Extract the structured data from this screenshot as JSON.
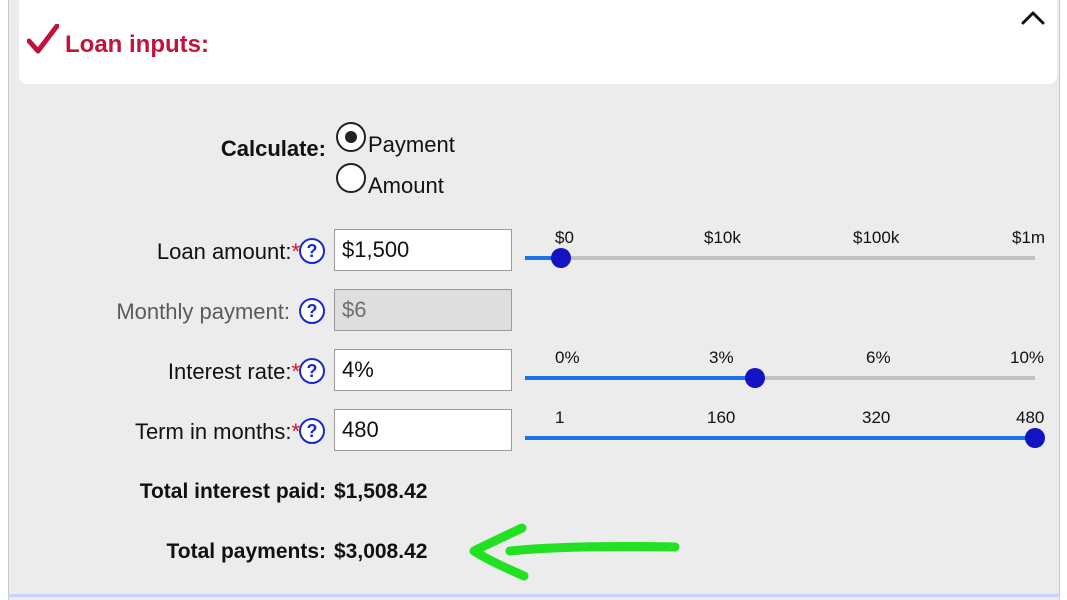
{
  "header": {
    "title": "Loan inputs:"
  },
  "calculate": {
    "label": "Calculate:",
    "options": [
      {
        "label": "Payment",
        "selected": true
      },
      {
        "label": "Amount",
        "selected": false
      }
    ]
  },
  "fields": {
    "loan_amount": {
      "label": "Loan amount:",
      "required_mark": "*",
      "value": "$1,500"
    },
    "monthly_payment": {
      "label": "Monthly payment:",
      "value": "$6"
    },
    "interest_rate": {
      "label": "Interest rate:",
      "required_mark": "*",
      "value": "4%"
    },
    "term": {
      "label": "Term in months:",
      "required_mark": "*",
      "value": "480"
    },
    "help_symbol": "?"
  },
  "sliders": {
    "loan_amount": {
      "ticks": [
        "$0",
        "$10k",
        "$100k",
        "$1m"
      ],
      "level": 0.07
    },
    "interest_rate": {
      "ticks": [
        "0%",
        "3%",
        "6%",
        "10%"
      ],
      "level": 0.45
    },
    "term": {
      "ticks": [
        "1",
        "160",
        "320",
        "480"
      ],
      "level": 1.0
    }
  },
  "results": {
    "total_interest_label": "Total interest paid:",
    "total_interest_value": "$1,508.42",
    "total_payments_label": "Total payments:",
    "total_payments_value": "$3,008.42"
  },
  "colors": {
    "title": "#c0143c",
    "slider_fill": "#1a73e8",
    "slider_thumb": "#1413c4",
    "annotation_arrow": "#22e022"
  },
  "icons": [
    "checkmark-icon",
    "chevron-up-icon",
    "help-icon",
    "green-arrow-annotation"
  ]
}
